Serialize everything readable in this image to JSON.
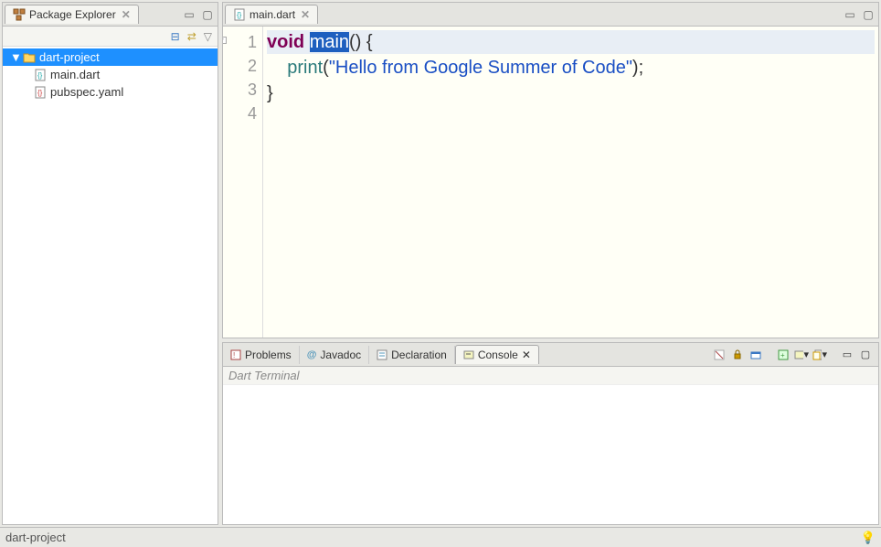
{
  "packageExplorer": {
    "title": "Package Explorer",
    "project": "dart-project",
    "files": [
      "main.dart",
      "pubspec.yaml"
    ]
  },
  "editor": {
    "activeTab": "main.dart",
    "lines": {
      "l1": {
        "num": "1",
        "kw": "void",
        "sel": "main",
        "rest": "() {"
      },
      "l2": {
        "num": "2",
        "indent": "    ",
        "fn": "print",
        "p1": "(",
        "str": "\"Hello from Google Summer of Code\"",
        "p2": ");"
      },
      "l3": {
        "num": "3",
        "text": "}"
      },
      "l4": {
        "num": "4",
        "text": ""
      }
    }
  },
  "views": {
    "problems": "Problems",
    "javadoc": "Javadoc",
    "declaration": "Declaration",
    "console": "Console"
  },
  "console": {
    "label": "Dart Terminal"
  },
  "statusbar": {
    "left": "dart-project"
  }
}
